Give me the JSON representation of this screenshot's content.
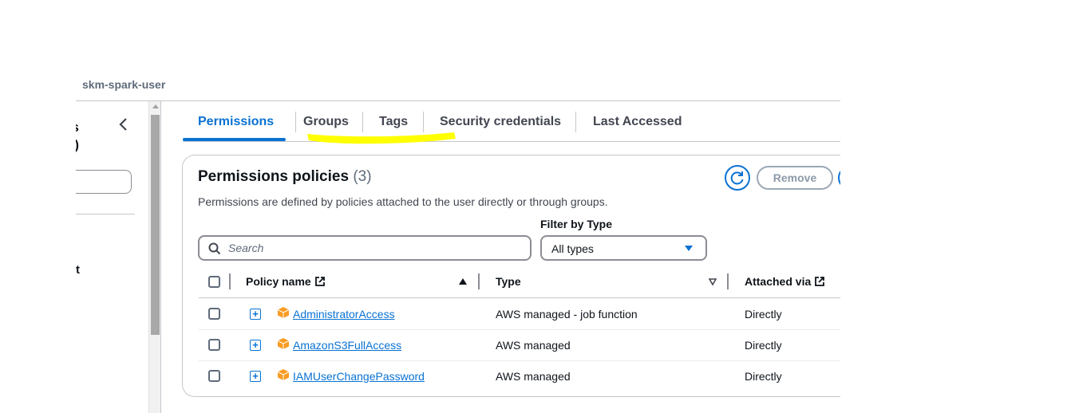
{
  "breadcrumb": {
    "current": "skm-spark-user"
  },
  "nav": {
    "title_line1": "ess",
    "title_line2": "M)",
    "item_fragment": "t"
  },
  "tabs": [
    {
      "label": "Permissions",
      "active": true
    },
    {
      "label": "Groups",
      "active": false
    },
    {
      "label": "Tags",
      "active": false
    },
    {
      "label": "Security credentials",
      "active": false
    },
    {
      "label": "Last Accessed",
      "active": false
    }
  ],
  "panel": {
    "title": "Permissions policies",
    "count": "(3)",
    "description": "Permissions are defined by policies attached to the user directly or through groups.",
    "remove_label": "Remove"
  },
  "filters": {
    "search_placeholder": "Search",
    "filter_label": "Filter by Type",
    "type_value": "All types"
  },
  "table": {
    "columns": [
      "Policy name",
      "Type",
      "Attached via"
    ],
    "rows": [
      {
        "name": "AdministratorAccess",
        "type": "AWS managed - job function",
        "attached": "Directly"
      },
      {
        "name": "AmazonS3FullAccess",
        "type": "AWS managed",
        "attached": "Directly"
      },
      {
        "name": "IAMUserChangePassword",
        "type": "AWS managed",
        "attached": "Directly"
      }
    ]
  },
  "colors": {
    "accent": "#0972d3",
    "highlight": "#ffff00",
    "text": "#0f141a",
    "muted": "#5f6b7a",
    "cube": "#f89c24"
  }
}
